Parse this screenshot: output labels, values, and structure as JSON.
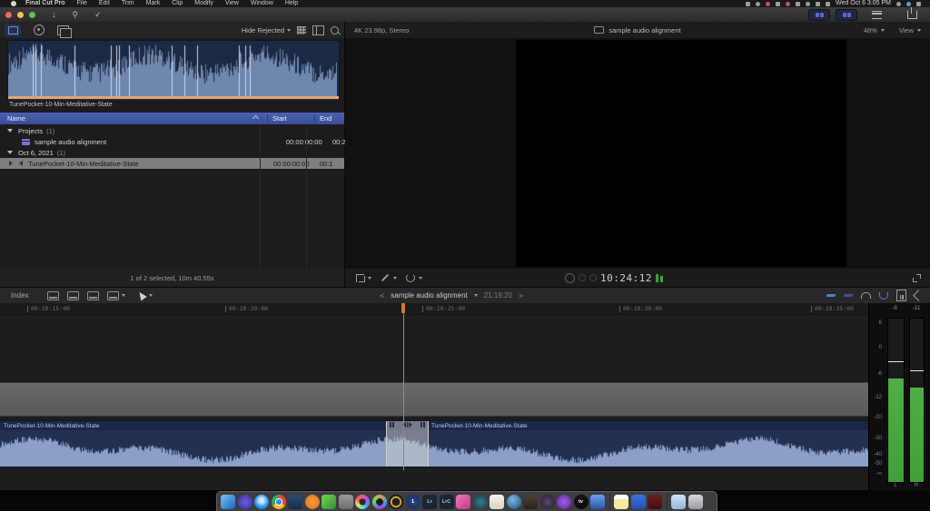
{
  "menu_bar": {
    "items": [
      "Final Cut Pro",
      "File",
      "Edit",
      "Trim",
      "Mark",
      "Clip",
      "Modify",
      "View",
      "Window",
      "Help"
    ],
    "clock": "Wed Oct 6  3:05 PM"
  },
  "browser": {
    "hide_rejected": "Hide Rejected",
    "filmstrip_label": "TunePocket-10-Min-Meditative-State",
    "columns": {
      "name": "Name",
      "start": "Start",
      "end": "End"
    },
    "rows": [
      {
        "kind": "group",
        "label": "Projects",
        "count": "(1)"
      },
      {
        "kind": "item",
        "label": "sample audio alignment",
        "start": "00:00:00:00",
        "end": "00:2"
      },
      {
        "kind": "group",
        "label": "Oct 6, 2021",
        "count": "(1)"
      },
      {
        "kind": "item",
        "label": "TunePocket-10-Min-Meditative-State",
        "start": "00:00:00:00",
        "end": "00:1",
        "selected": true
      }
    ],
    "status": "1 of 2 selected, 10m 40.55s"
  },
  "viewer": {
    "format_info": "4K 23.98p, Stereo",
    "title": "sample audio alignment",
    "zoom_level": "48%",
    "view_label": "View",
    "timecode": "10:24:12"
  },
  "timeline": {
    "index_label": "Index",
    "project_title": "sample audio alignment",
    "project_timecode": "21:19:20",
    "nav_prev": "<",
    "nav_next": ">",
    "ruler_ticks": [
      "00:10:15:00",
      "00:10:20:00",
      "00:10:25:00",
      "00:10:30:00",
      "00:10:35:00"
    ],
    "clip_left_label": "TunePocket-10-Min-Meditative-State",
    "clip_right_label": "TunePocket-10-Min-Meditative-State"
  },
  "meters": {
    "peak_left": "-8",
    "peak_right": "-11",
    "scale": [
      "6",
      "0",
      "-6",
      "-12",
      "-20",
      "-30",
      "-40",
      "-50",
      "-∞"
    ],
    "channel_left": "L",
    "channel_right": "R"
  },
  "colors": {
    "accent_orange": "#cf7a2e",
    "wave_blue": "#8aa0c6",
    "filmstrip_wave": "#6e87ad",
    "meter_green": "#3f9f3a",
    "header_blue": "#4d61b2",
    "selection_gray": "#7e7e7e"
  },
  "dock": {
    "apps": [
      {
        "name": "finder",
        "bg": "linear-gradient(135deg,#79c3f4,#1667c0)",
        "shape": "square"
      },
      {
        "name": "umbrella-app",
        "bg": "radial-gradient(circle,#6a5ae0,#3a2f9a)",
        "shape": "circle"
      },
      {
        "name": "safari",
        "bg": "radial-gradient(circle at 50% 40%,#cfeaff 0 18%,#1f8ef0 60%)",
        "shape": "circle"
      },
      {
        "name": "chrome",
        "bg": "radial-gradient(circle at 50% 50%,#4285f4 0 28%,#ffffff 28% 36%,rgba(0,0,0,0) 36%),conic-gradient(#ea4335 0deg 120deg,#fbbc05 120deg 240deg,#34a853 240deg 360deg)",
        "shape": "circle"
      },
      {
        "name": "display-app",
        "bg": "linear-gradient(#2c4a72,#1a2c48)",
        "shape": "square"
      },
      {
        "name": "orange-circle-app",
        "bg": "radial-gradient(circle,#f6a13c,#d96a1e)",
        "shape": "circle"
      },
      {
        "name": "photo-editor-app",
        "bg": "linear-gradient(135deg,#7ad34e,#2e8f3a)",
        "shape": "square"
      },
      {
        "name": "camera-app",
        "bg": "linear-gradient(#9a9a9a,#6f6f6f)",
        "shape": "square"
      },
      {
        "name": "final-cut-pro",
        "bg": "radial-gradient(circle at 50% 50%,#2a2a2a 0 32%,rgba(0,0,0,0) 32%),conic-gradient(#f55a8a,#a05ae8,#5a8af5,#5ae8c0,#f5e05a,#f55a5a,#f55a8a)",
        "shape": "circle"
      },
      {
        "name": "davinci-resolve",
        "bg": "radial-gradient(circle at 50% 50%,#1c1c1c 0 34%,rgba(0,0,0,0) 34%),conic-gradient(#e8a23c,#3ca2e8,#a23ce8,#3ce87a,#e8a23c)",
        "shape": "circle"
      },
      {
        "name": "gold-circle-app",
        "bg": "radial-gradient(circle at 50% 50%,#2a2118 0 38%,#c9a23c 38% 56%,#171310 56%)",
        "shape": "circle"
      },
      {
        "name": "1password",
        "bg": "radial-gradient(circle,#2a4a8a,#132a55)",
        "shape": "circle",
        "text": "1"
      },
      {
        "name": "lightroom",
        "bg": "#1a2634",
        "shape": "square",
        "text": "Lr",
        "fg": "#9ec3e8"
      },
      {
        "name": "lightroom-classic",
        "bg": "#1a2634",
        "shape": "square",
        "text": "LrC",
        "fg": "#9ec3e8"
      },
      {
        "name": "pink-app",
        "bg": "linear-gradient(135deg,#f07ab8,#c23a8a)",
        "shape": "square"
      },
      {
        "name": "teal-app",
        "bg": "radial-gradient(circle,#3a7a8a,#173a45)",
        "shape": "circle"
      },
      {
        "name": "white-document-app",
        "bg": "linear-gradient(#f5f2ea,#d8d2c2)",
        "shape": "square"
      },
      {
        "name": "blue-sphere-app",
        "bg": "radial-gradient(circle at 40% 35%,#7ab8e8,#1a4a7a)",
        "shape": "circle"
      },
      {
        "name": "dark-case-app",
        "bg": "linear-gradient(#4a4038,#2a241e)",
        "shape": "square"
      },
      {
        "name": "disc-app",
        "bg": "radial-gradient(circle,#5a4a6a,#241a30)",
        "shape": "circle"
      },
      {
        "name": "purple-circle-app",
        "bg": "radial-gradient(circle,#a05ae8,#5a2a9a)",
        "shape": "circle"
      },
      {
        "name": "apple-tv",
        "bg": "#101010",
        "shape": "circle",
        "text": "tv"
      },
      {
        "name": "blue-device-app",
        "bg": "linear-gradient(#6aa0e8,#2a5aa8)",
        "shape": "square"
      },
      {
        "sep": true
      },
      {
        "name": "notes",
        "bg": "linear-gradient(#ffffff 0 30%,#f7e9a0 30%)",
        "shape": "square"
      },
      {
        "name": "dropbox",
        "bg": "linear-gradient(#3a74e0,#2452b0)",
        "shape": "square"
      },
      {
        "name": "red-book-app",
        "bg": "linear-gradient(#6a2020,#431010)",
        "shape": "square"
      },
      {
        "sep": true
      },
      {
        "name": "downloads-folder",
        "bg": "linear-gradient(#cfe3f5,#8fb8dd)",
        "shape": "square"
      },
      {
        "name": "trash",
        "bg": "linear-gradient(#d8d8dc,#9a9aa0)",
        "shape": "square"
      }
    ]
  }
}
